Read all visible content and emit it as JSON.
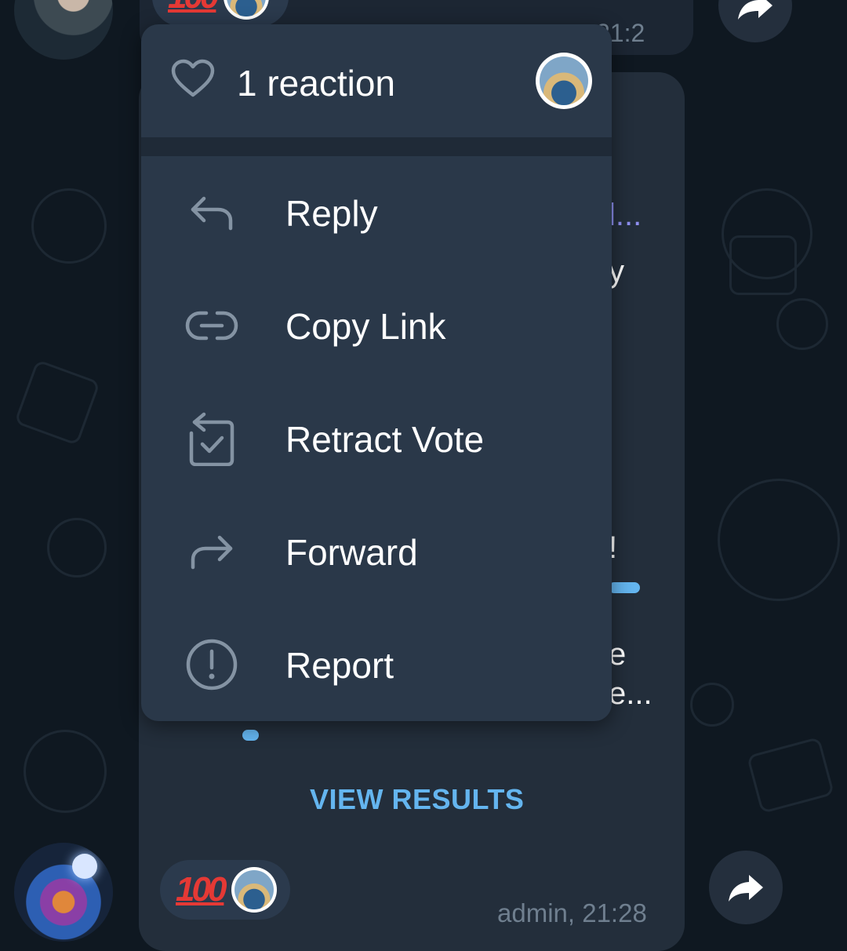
{
  "top_message": {
    "time": "21:2"
  },
  "poll": {
    "fragments": [
      "l...",
      "y",
      "!",
      "e",
      "e..."
    ],
    "view_results_label": "VIEW RESULTS",
    "meta": "admin, 21:28",
    "reaction": {
      "emoji": "💯",
      "emoji_text": "100"
    }
  },
  "context_menu": {
    "reaction_header": {
      "count_label": "1 reaction"
    },
    "items": [
      {
        "label": "Reply",
        "icon": "reply-icon"
      },
      {
        "label": "Copy Link",
        "icon": "link-icon"
      },
      {
        "label": "Retract Vote",
        "icon": "retract-vote-icon"
      },
      {
        "label": "Forward",
        "icon": "forward-icon"
      },
      {
        "label": "Report",
        "icon": "report-icon"
      }
    ]
  },
  "colors": {
    "background": "#0f1821",
    "bubble": "#232e3b",
    "menu": "#2a3849",
    "accent": "#64b5ef",
    "icon": "#8493a3"
  }
}
